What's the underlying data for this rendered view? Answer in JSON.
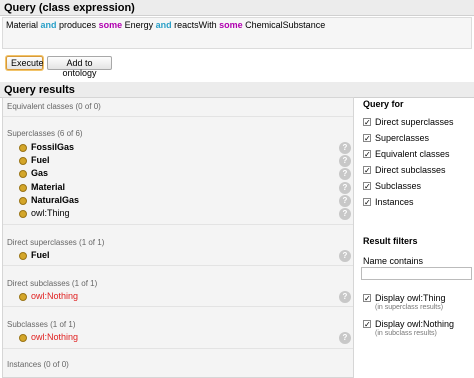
{
  "query": {
    "header": "Query (class expression)",
    "expression": [
      {
        "text": "Material ",
        "kind": "plain"
      },
      {
        "text": "and",
        "kind": "and"
      },
      {
        "text": " produces ",
        "kind": "plain"
      },
      {
        "text": "some",
        "kind": "some"
      },
      {
        "text": " Energy ",
        "kind": "plain"
      },
      {
        "text": "and",
        "kind": "and"
      },
      {
        "text": " reactsWith ",
        "kind": "plain"
      },
      {
        "text": "some",
        "kind": "some"
      },
      {
        "text": " ChemicalSubstance",
        "kind": "plain"
      }
    ],
    "execute_label": "Execute",
    "add_label": "Add to ontology"
  },
  "results": {
    "header": "Query results",
    "sections": {
      "equivalent": {
        "title": "Equivalent classes (0 of 0)",
        "items": []
      },
      "superclasses": {
        "title": "Superclasses (6 of 6)",
        "items": [
          {
            "label": "FossilGas",
            "style": "bold"
          },
          {
            "label": "Fuel",
            "style": "bold"
          },
          {
            "label": "Gas",
            "style": "bold"
          },
          {
            "label": "Material",
            "style": "bold"
          },
          {
            "label": "NaturalGas",
            "style": "bold"
          },
          {
            "label": "owl:Thing",
            "style": "plain"
          }
        ]
      },
      "direct_superclasses": {
        "title": "Direct superclasses (1 of 1)",
        "items": [
          {
            "label": "Fuel",
            "style": "bold"
          }
        ]
      },
      "direct_subclasses": {
        "title": "Direct subclasses (1 of 1)",
        "items": [
          {
            "label": "owl:Nothing",
            "style": "red"
          }
        ]
      },
      "subclasses": {
        "title": "Subclasses (1 of 1)",
        "items": [
          {
            "label": "owl:Nothing",
            "style": "red"
          }
        ]
      },
      "instances": {
        "title": "Instances (0 of 0)",
        "items": []
      }
    },
    "explain_glyph": "?"
  },
  "side": {
    "query_for_title": "Query for",
    "options": [
      {
        "label": "Direct superclasses",
        "checked": true
      },
      {
        "label": "Superclasses",
        "checked": true
      },
      {
        "label": "Equivalent classes",
        "checked": true
      },
      {
        "label": "Direct subclasses",
        "checked": true
      },
      {
        "label": "Subclasses",
        "checked": true
      },
      {
        "label": "Instances",
        "checked": true
      }
    ],
    "filters_title": "Result filters",
    "name_contains_label": "Name contains",
    "name_contains_value": "",
    "display_thing": {
      "label": "Display owl:Thing",
      "sub": "(in superclass results)",
      "checked": true
    },
    "display_nothing": {
      "label": "Display owl:Nothing",
      "sub": "(in subclass results)",
      "checked": true
    }
  }
}
